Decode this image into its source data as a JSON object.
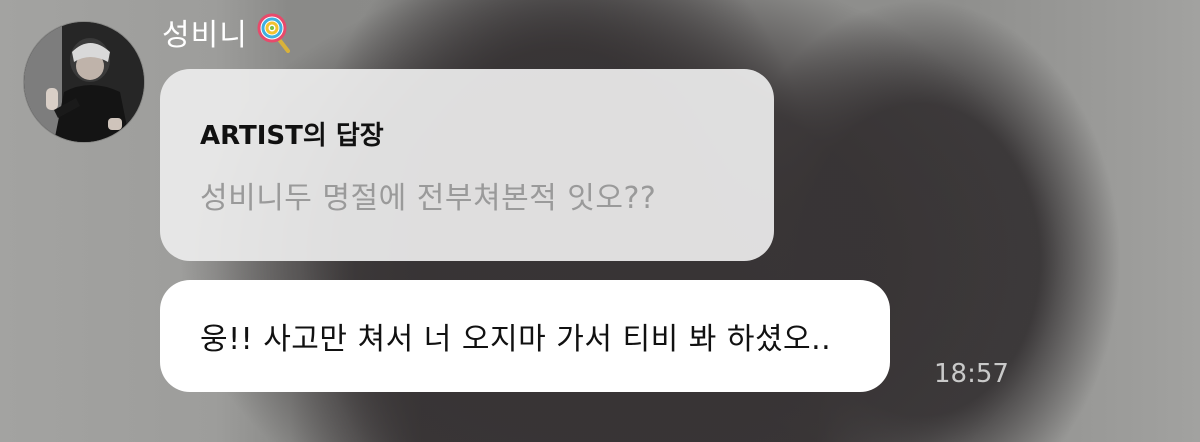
{
  "chat": {
    "sender_name": "성비니",
    "sender_emoji_icon": "lollipop-icon",
    "quoted_reply": {
      "title": "ARTIST의 답장",
      "text": "성비니두 명절에 전부쳐본적 잇오??"
    },
    "message": {
      "text": "웅!! 사고만 쳐서 너 오지마 가서 티비 봐 하셨오..",
      "time": "18:57"
    }
  },
  "colors": {
    "quote_bubble_bg": "#ececec",
    "reply_bubble_bg": "#ffffff",
    "quote_text": "#9a9a9a",
    "timestamp": "#c9c9c9"
  }
}
